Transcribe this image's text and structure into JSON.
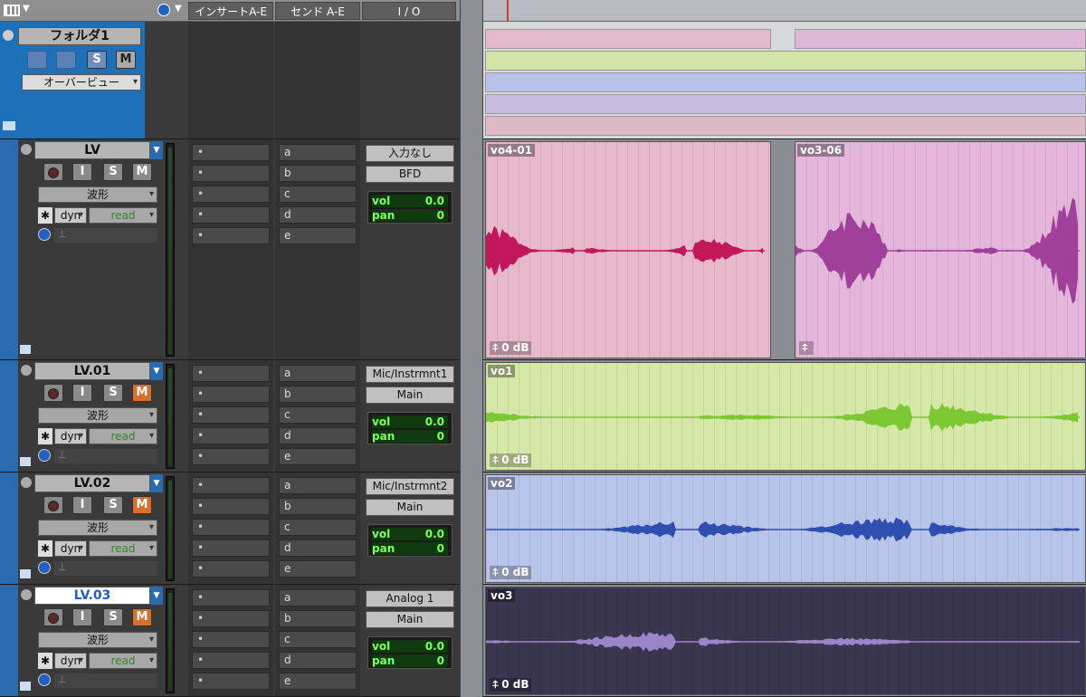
{
  "header": {
    "view_icon": "grid-icon",
    "clock_icon": "clock-icon",
    "inserts": "インサートA-E",
    "sends": "センド A-E",
    "io": "I / O"
  },
  "folder": {
    "name": "フォルダ1",
    "solo": "S",
    "mute": "M",
    "overview": "オーバービュー",
    "icon": "folder-icon"
  },
  "colors": {
    "lv": "#c2185b",
    "lv01": "#7cc832",
    "lv02": "#2f4fb0",
    "lv03": "#9b84c9"
  },
  "tracks": [
    {
      "name": "LV",
      "input": "I",
      "solo": "S",
      "mute": "M",
      "view": "波形",
      "dyn": "dyn",
      "auto": "read",
      "sends": [
        "a",
        "b",
        "c",
        "d",
        "e"
      ],
      "io_in": "入力なし",
      "io_out": "BFD",
      "vol_label": "vol",
      "vol": "0.0",
      "pan_label": "pan",
      "pan": "0"
    },
    {
      "name": "LV.01",
      "input": "I",
      "solo": "S",
      "mute": "M",
      "view": "波形",
      "dyn": "dyn",
      "auto": "read",
      "sends": [
        "a",
        "b",
        "c",
        "d",
        "e"
      ],
      "io_in": "Mic/Instrmnt1",
      "io_out": "Main",
      "vol_label": "vol",
      "vol": "0.0",
      "pan_label": "pan",
      "pan": "0"
    },
    {
      "name": "LV.02",
      "input": "I",
      "solo": "S",
      "mute": "M",
      "view": "波形",
      "dyn": "dyn",
      "auto": "read",
      "sends": [
        "a",
        "b",
        "c",
        "d",
        "e"
      ],
      "io_in": "Mic/Instrmnt2",
      "io_out": "Main",
      "vol_label": "vol",
      "vol": "0.0",
      "pan_label": "pan",
      "pan": "0"
    },
    {
      "name": "LV.03",
      "input": "I",
      "solo": "S",
      "mute": "M",
      "view": "波形",
      "dyn": "dyn",
      "auto": "read",
      "sends": [
        "a",
        "b",
        "c",
        "d",
        "e"
      ],
      "io_in": "Analog 1",
      "io_out": "Main",
      "vol_label": "vol",
      "vol": "0.0",
      "pan_label": "pan",
      "pan": "0"
    }
  ],
  "clips": {
    "lv_a": "vo4-01",
    "lv_b": "vo3-06",
    "lv01": "vo1",
    "lv02": "vo2",
    "lv03": "vo3",
    "gain": "0 dB"
  }
}
